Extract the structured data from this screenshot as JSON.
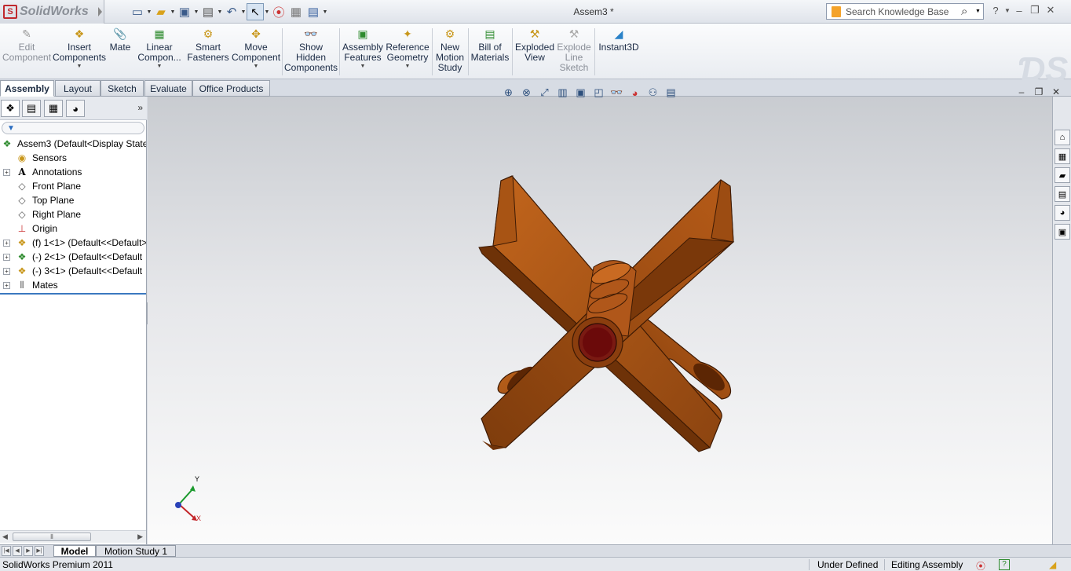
{
  "app": {
    "name": "SolidWorks",
    "document_title": "Assem3 *"
  },
  "search": {
    "placeholder": "Search Knowledge Base"
  },
  "ribbon": {
    "buttons": [
      {
        "label": "Edit\nComponent",
        "icon": "edit-component-icon",
        "enabled": false
      },
      {
        "label": "Insert\nComponents",
        "icon": "insert-components-icon",
        "dropdown": true
      },
      {
        "label": "Mate",
        "icon": "mate-icon"
      },
      {
        "label": "Linear\nCompon...",
        "icon": "linear-pattern-icon",
        "dropdown": true
      },
      {
        "label": "Smart\nFasteners",
        "icon": "smart-fasteners-icon"
      },
      {
        "label": "Move\nComponent",
        "icon": "move-component-icon",
        "dropdown": true
      },
      {
        "label": "Show\nHidden\nComponents",
        "icon": "show-hidden-icon"
      },
      {
        "label": "Assembly\nFeatures",
        "icon": "assembly-features-icon",
        "dropdown": true
      },
      {
        "label": "Reference\nGeometry",
        "icon": "reference-geometry-icon",
        "dropdown": true
      },
      {
        "label": "New\nMotion\nStudy",
        "icon": "motion-study-icon"
      },
      {
        "label": "Bill of\nMaterials",
        "icon": "bill-of-materials-icon"
      },
      {
        "label": "Exploded\nView",
        "icon": "exploded-view-icon"
      },
      {
        "label": "Explode\nLine\nSketch",
        "icon": "explode-line-sketch-icon",
        "enabled": false
      },
      {
        "label": "Instant3D",
        "icon": "instant3d-icon"
      }
    ]
  },
  "tabs": [
    "Assembly",
    "Layout",
    "Sketch",
    "Evaluate",
    "Office Products"
  ],
  "active_tab": "Assembly",
  "tree": {
    "root": "Assem3  (Default<Display State",
    "items": [
      {
        "label": "Sensors",
        "icon": "sensors-icon",
        "expandable": false
      },
      {
        "label": "Annotations",
        "icon": "annotations-icon",
        "expandable": true
      },
      {
        "label": "Front Plane",
        "icon": "plane-icon",
        "expandable": false
      },
      {
        "label": "Top Plane",
        "icon": "plane-icon",
        "expandable": false
      },
      {
        "label": "Right Plane",
        "icon": "plane-icon",
        "expandable": false
      },
      {
        "label": "Origin",
        "icon": "origin-icon",
        "expandable": false
      },
      {
        "label": "(f) 1<1> (Default<<Default>",
        "icon": "part-icon",
        "expandable": true
      },
      {
        "label": "(-) 2<1> (Default<<Default",
        "icon": "subassembly-icon",
        "expandable": true
      },
      {
        "label": "(-) 3<1> (Default<<Default",
        "icon": "part-icon",
        "expandable": true
      },
      {
        "label": "Mates",
        "icon": "mates-icon",
        "expandable": true
      }
    ]
  },
  "triad": {
    "x": "X",
    "y": "Y"
  },
  "bottom_tabs": [
    "Model",
    "Motion Study 1"
  ],
  "status": {
    "product": "SolidWorks Premium 2011",
    "definition": "Under Defined",
    "mode": "Editing Assembly"
  },
  "colors": {
    "model_orange": "#a24f12",
    "model_shadow": "#5c2604",
    "bore": "#6b0a0a",
    "accent": "#3b78c0"
  }
}
